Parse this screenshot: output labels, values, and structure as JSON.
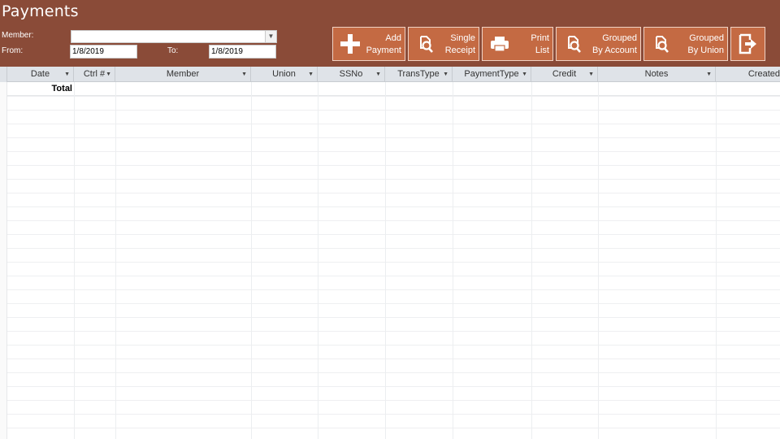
{
  "header": {
    "title": "Payments",
    "member_label": "Member:",
    "from_label": "From:",
    "to_label": "To:",
    "member_value": "",
    "from_value": "1/8/2019",
    "to_value": "1/8/2019"
  },
  "buttons": {
    "add_payment": [
      "Add",
      "Payment"
    ],
    "single_receipt": [
      "Single",
      "Receipt"
    ],
    "print_list": [
      "Print",
      "List"
    ],
    "grouped_account": [
      "Grouped",
      "By Account"
    ],
    "grouped_union": [
      "Grouped",
      "By Union"
    ]
  },
  "icons": {
    "add": "plus-icon",
    "single_receipt": "magnifier-icon",
    "print": "printer-icon",
    "grouped_account": "magnifier-icon",
    "grouped_union": "magnifier-icon",
    "exit": "exit-icon"
  },
  "columns": [
    "Date",
    "Ctrl #",
    "Member",
    "Union",
    "SSNo",
    "TransType",
    "PaymentType",
    "Credit",
    "Notes",
    "Created"
  ],
  "totals": {
    "label": "Total"
  },
  "colors": {
    "header_bg": "#8a4b38",
    "button_bg": "#c46a43",
    "grid_header_bg": "#dfe3e8"
  }
}
